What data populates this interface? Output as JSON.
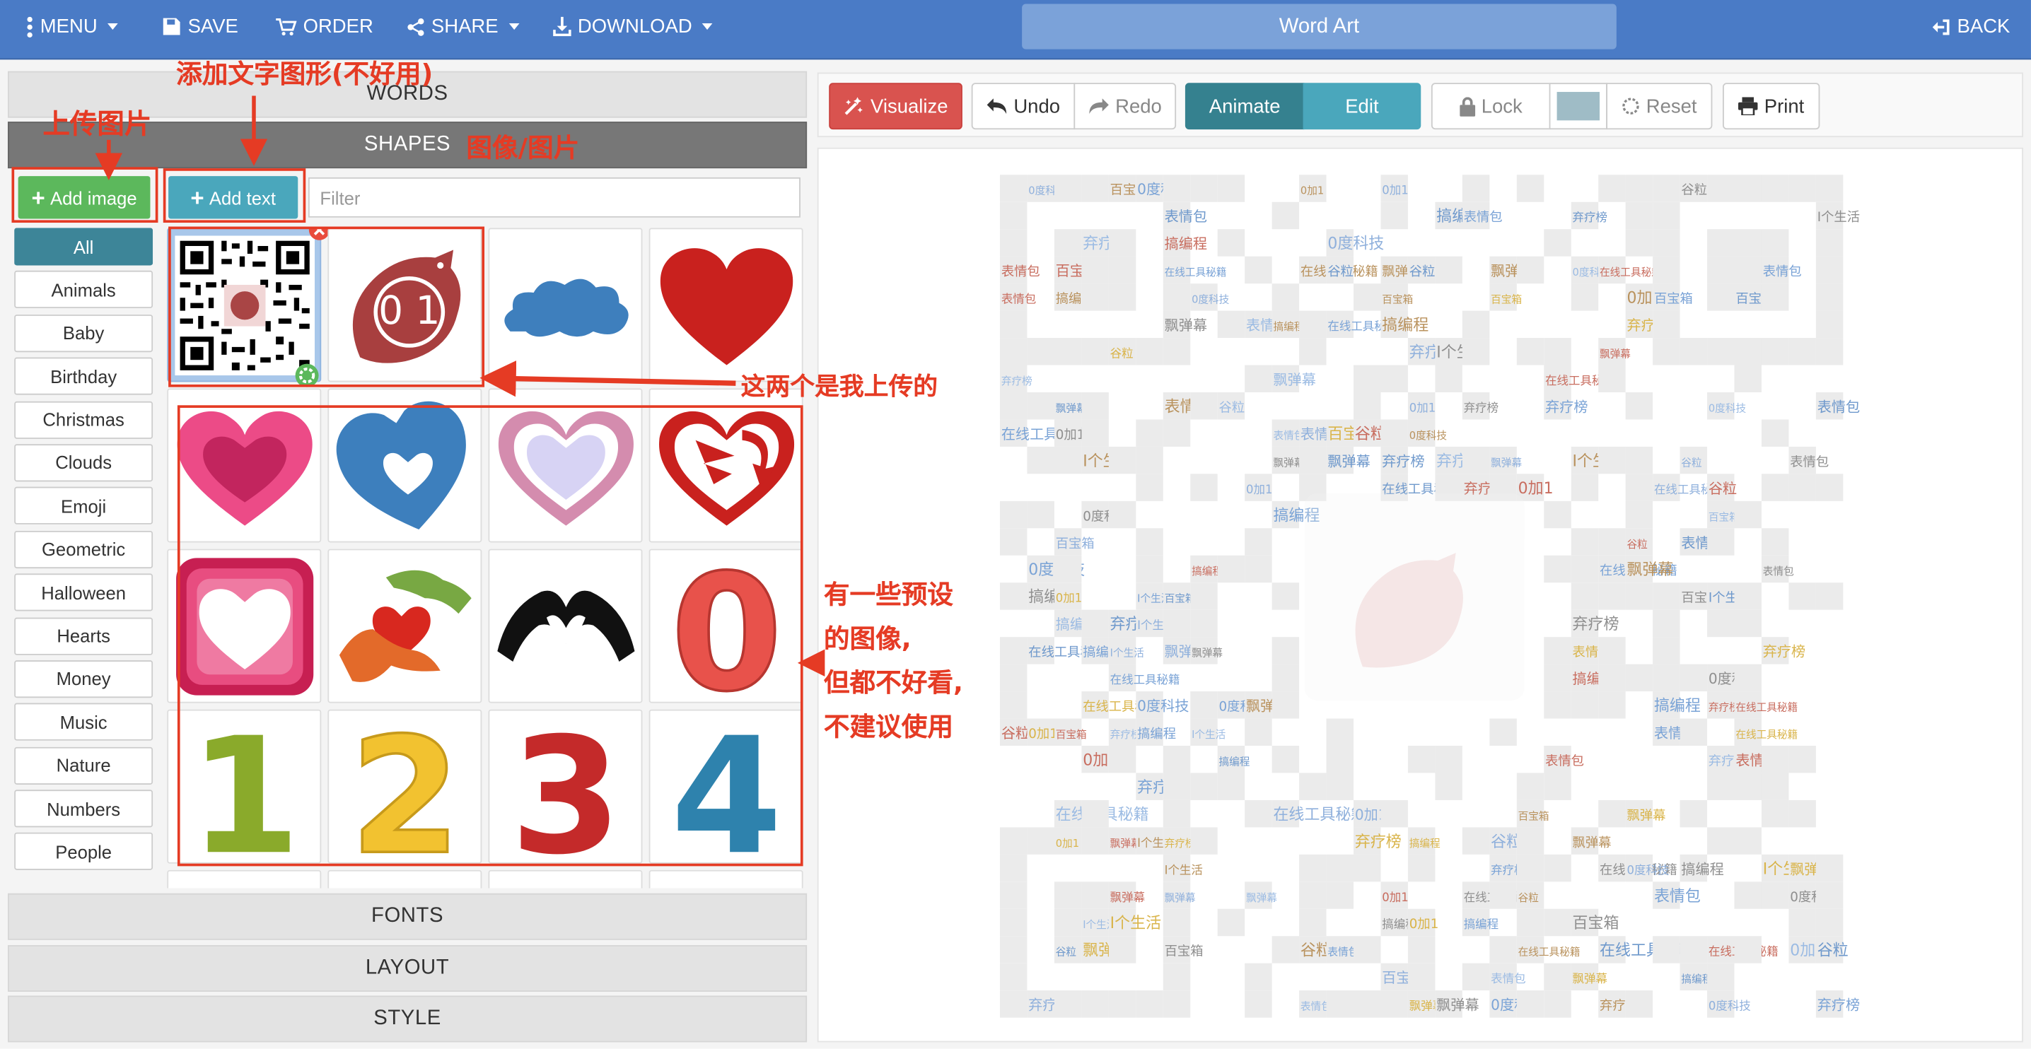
{
  "topbar": {
    "menu": "MENU",
    "save": "SAVE",
    "order": "ORDER",
    "share": "SHARE",
    "download": "DOWNLOAD",
    "title": "Word Art",
    "back": "BACK"
  },
  "panels": {
    "words": "WORDS",
    "shapes": "SHAPES",
    "fonts": "FONTS",
    "layout": "LAYOUT",
    "style": "STYLE"
  },
  "shapes": {
    "add_image": "Add image",
    "add_text": "Add text",
    "filter_placeholder": "Filter",
    "categories": [
      "All",
      "Animals",
      "Baby",
      "Birthday",
      "Christmas",
      "Clouds",
      "Emoji",
      "Geometric",
      "Halloween",
      "Hearts",
      "Money",
      "Music",
      "Nature",
      "Numbers",
      "People"
    ],
    "active_category": "All",
    "upload_badge_text": "0 1",
    "number_tiles": [
      "1",
      "2",
      "3",
      "4"
    ],
    "preset_zero": "0"
  },
  "toolbar": {
    "visualize": "Visualize",
    "undo": "Undo",
    "redo": "Redo",
    "animate": "Animate",
    "edit": "Edit",
    "lock": "Lock",
    "reset": "Reset",
    "print": "Print"
  },
  "annotations": {
    "add_text_note": "添加文字图形(不好用)",
    "upload_note": "上传图片",
    "shapes_note": "图像/图片",
    "uploaded_note": "这两个是我上传的",
    "preset_note_1": "有一些预设",
    "preset_note_2": "的图像,",
    "preset_note_3": "但都不好看,",
    "preset_note_4": "不建议使用"
  },
  "word_cloud": {
    "words": [
      "弃疗榜",
      "在线工具秘籍",
      "百宝箱",
      "表情包",
      "0度科技",
      "I个生活",
      "谷粒",
      "飘弹幕",
      "搞编程",
      "0加1"
    ]
  },
  "colors": {
    "accent_red": "#e53b24",
    "topbar_blue": "#4a7bc6",
    "green": "#5cb85c",
    "teal": "#4aa7bc"
  }
}
